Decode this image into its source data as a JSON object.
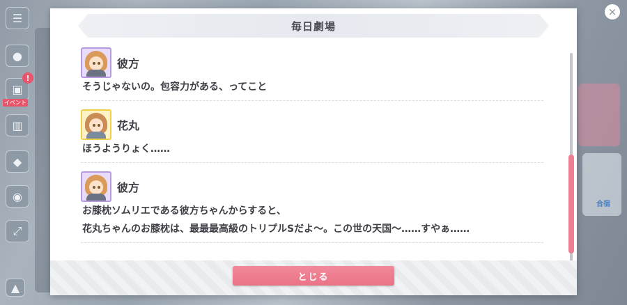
{
  "dialog": {
    "title": "毎日劇場",
    "close_label": "とじる"
  },
  "log": [
    {
      "speaker": "彼方",
      "avatar": "kanata-portrait",
      "lines": [
        "そうじゃないの。包容力がある、ってこと"
      ]
    },
    {
      "speaker": "花丸",
      "avatar": "hanamaru-portrait",
      "lines": [
        "ほうようりょく……"
      ]
    },
    {
      "speaker": "彼方",
      "avatar": "kanata-portrait",
      "lines": [
        "お膝枕ソムリエである彼方ちゃんからすると、",
        "花丸ちゃんのお膝枕は、最最最高級のトリプルSだよ〜。この世の天国〜……すやぁ……"
      ]
    }
  ],
  "background": {
    "event_label": "イベント",
    "right_label": "合宿"
  },
  "colors": {
    "accent": "#ef7f92",
    "text": "#3e3e46",
    "kanata_frame": "#b79be0",
    "hanamaru_frame": "#f2cf4a"
  }
}
